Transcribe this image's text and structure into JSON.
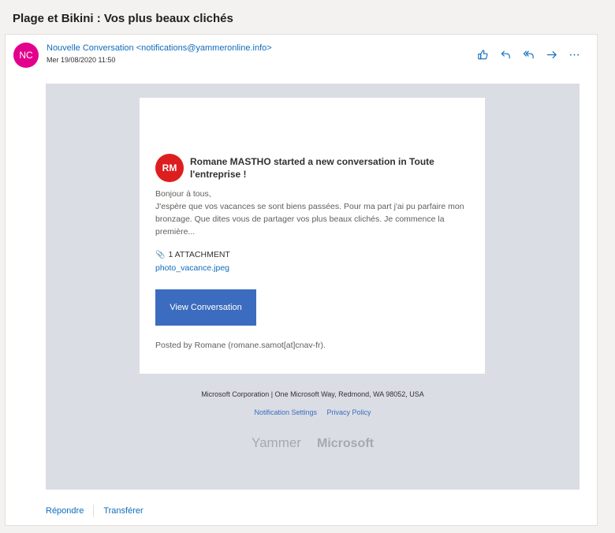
{
  "email": {
    "subject": "Plage et Bikini : Vos plus beaux clichés",
    "sender_initials": "NC",
    "sender": "Nouvelle Conversation <notifications@yammeronline.info>",
    "date": "Mer 19/08/2020 11:50"
  },
  "colors": {
    "sender_avatar": "#e3008c",
    "rm_avatar": "#dd1e1e",
    "button": "#3b6cbf",
    "body_bg": "#dadde4"
  },
  "icons": [
    "thumbs-up-icon",
    "reply-icon",
    "reply-all-icon",
    "forward-icon",
    "more-icon",
    "paperclip-icon"
  ],
  "message": {
    "poster_initials": "RM",
    "headline": "Romane MASTHO started a new conversation in Toute l'entreprise !",
    "line1": "Bonjour à tous,",
    "line2": "J'espère que vos vacances se sont biens passées. Pour ma part j'ai pu parfaire mon bronzage. Que dites vous de partager vos plus beaux clichés. Je commence la première...",
    "attachment_label": "1 ATTACHMENT",
    "attachment_file": "photo_vacance.jpeg",
    "button_label": "View Conversation",
    "posted_by": "Posted by Romane (romane.samot[at]cnav-fr)."
  },
  "footer": {
    "address": "Microsoft Corporation | One Microsoft Way, Redmond, WA 98052, USA",
    "link1": "Notification Settings",
    "link2": "Privacy Policy",
    "brand1": "Yammer",
    "brand2": "Microsoft"
  },
  "bottom": {
    "reply": "Répondre",
    "forward": "Transférer"
  }
}
